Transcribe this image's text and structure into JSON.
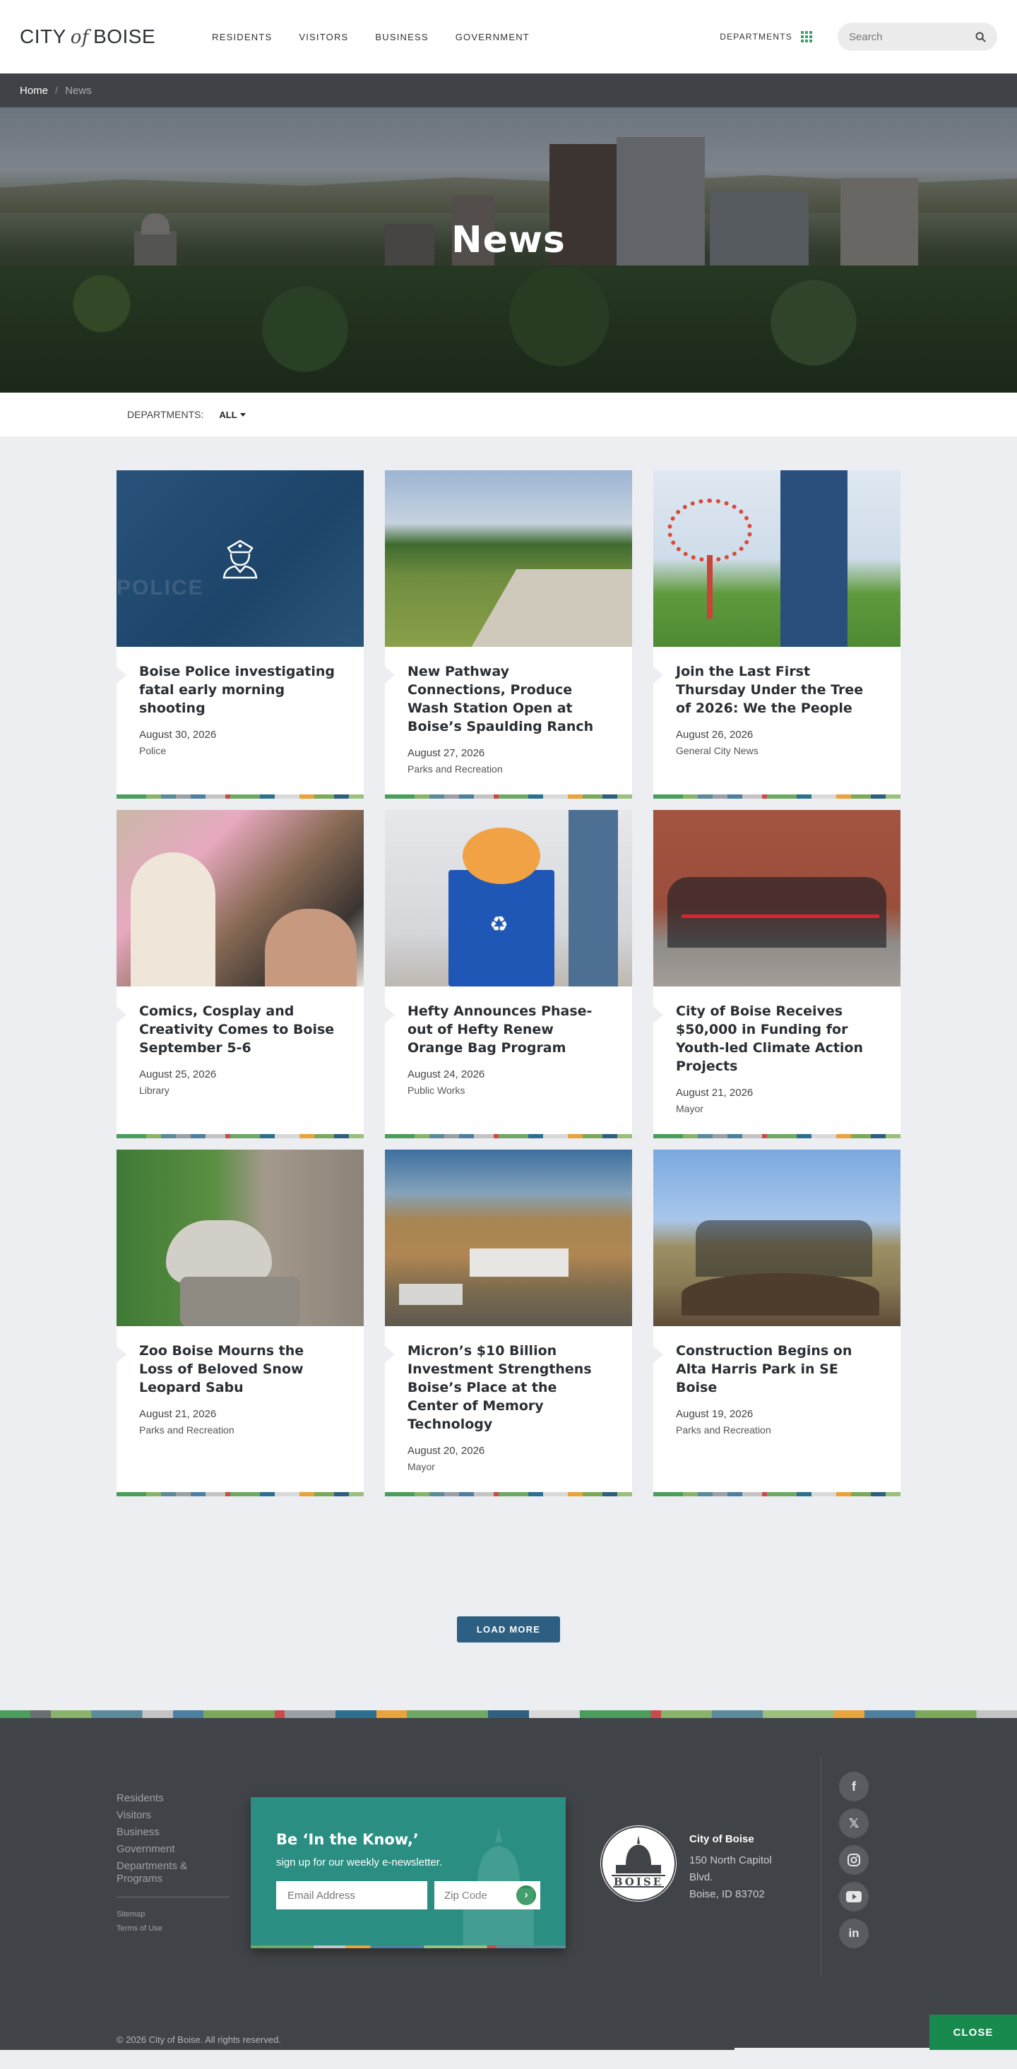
{
  "header": {
    "logo_city": "CITY",
    "logo_of": "of",
    "logo_boise": "BOISE",
    "nav": [
      "RESIDENTS",
      "VISITORS",
      "BUSINESS",
      "GOVERNMENT"
    ],
    "departments_label": "DEPARTMENTS",
    "search_placeholder": "Search"
  },
  "breadcrumb": {
    "home": "Home",
    "separator": "/",
    "current": "News"
  },
  "hero": {
    "title": "News"
  },
  "filter": {
    "label": "DEPARTMENTS:",
    "selected": "ALL"
  },
  "cards": [
    {
      "title": "Boise Police investigating fatal early morning shooting",
      "date": "August 30, 2026",
      "department": "Police",
      "image": "police-officer-icon-on-blue"
    },
    {
      "title": "New Pathway Connections, Produce Wash Station Open at Boise’s Spaulding Ranch",
      "date": "August 27, 2026",
      "department": "Parks and Recreation",
      "image": "paved-pathway-field"
    },
    {
      "title": "Join the Last First Thursday Under the Tree of 2026: We the People",
      "date": "August 26, 2026",
      "department": "General City News",
      "image": "red-tree-sculpture"
    },
    {
      "title": "Comics, Cosplay and Creativity Comes to Boise September 5-6",
      "date": "August 25, 2026",
      "department": "Library",
      "image": "comic-convention-crowd"
    },
    {
      "title": "Hefty Announces Phase-out of Hefty Renew Orange Bag Program",
      "date": "August 24, 2026",
      "department": "Public Works",
      "image": "blue-recycling-bin"
    },
    {
      "title": "City of Boise Receives $50,000 in Funding for Youth-led Climate Action Projects",
      "date": "August 21, 2026",
      "department": "Mayor",
      "image": "ribbon-cutting-bikes"
    },
    {
      "title": "Zoo Boise Mourns the Loss of Beloved Snow Leopard Sabu",
      "date": "August 21, 2026",
      "department": "Parks and Recreation",
      "image": "snow-leopard"
    },
    {
      "title": "Micron’s $10 Billion Investment Strengthens Boise’s Place at the Center of Memory Technology",
      "date": "August 20, 2026",
      "department": "Mayor",
      "image": "aerial-campus-foothills"
    },
    {
      "title": "Construction Begins on Alta Harris Park in SE Boise",
      "date": "August 19, 2026",
      "department": "Parks and Recreation",
      "image": "groundbreaking-shovels"
    }
  ],
  "load_more": "LOAD MORE",
  "footer": {
    "links": [
      "Residents",
      "Visitors",
      "Business",
      "Government",
      "Departments & Programs"
    ],
    "small_links": [
      "Sitemap",
      "Terms of Use"
    ],
    "newsletter": {
      "title": "Be ‘In the Know,’",
      "subtitle": "sign up for our weekly e-newsletter.",
      "email_placeholder": "Email Address",
      "zip_placeholder": "Zip Code"
    },
    "seal_text": "BOISE",
    "address": {
      "name": "City of Boise",
      "line1": "150 North Capitol",
      "line2": "Blvd.",
      "line3": "Boise, ID 83702"
    },
    "social": [
      "facebook-icon",
      "x-icon",
      "instagram-icon",
      "youtube-icon",
      "linkedin-icon"
    ],
    "copyright": "© 2026 City of Boise. All rights reserved.",
    "close": "CLOSE"
  },
  "colors": {
    "accent_blue": "#2c5f82",
    "green": "#198a4e",
    "teal": "#2a8f82",
    "footer_bg": "#404347"
  }
}
